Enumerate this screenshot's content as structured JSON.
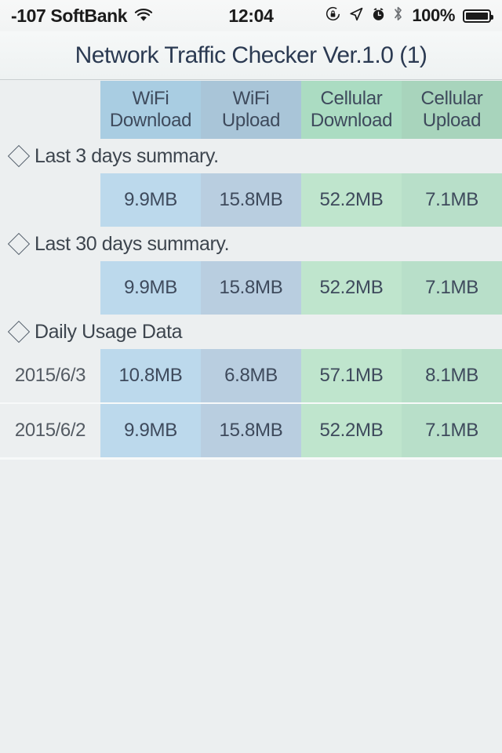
{
  "status_bar": {
    "carrier_signal": "-107",
    "carrier_name": "SoftBank",
    "carrier_text": "-107 SoftBank",
    "wifi_icon": "wifi-icon",
    "time": "12:04",
    "icons": [
      "rotation-lock-icon",
      "location-arrow-icon",
      "alarm-clock-icon",
      "bluetooth-icon"
    ],
    "battery_percent": "100%",
    "battery_level": 100
  },
  "navbar": {
    "title": "Network Traffic Checker Ver.1.0 (1)"
  },
  "table": {
    "columns": [
      {
        "line1": "WiFi",
        "line2": "Download",
        "key": "wifi_download",
        "color": "#a9cde2"
      },
      {
        "line1": "WiFi",
        "line2": "Upload",
        "key": "wifi_upload",
        "color": "#a9c5d8"
      },
      {
        "line1": "Cellular",
        "line2": "Download",
        "key": "cellular_download",
        "color": "#abdcc2"
      },
      {
        "line1": "Cellular",
        "line2": "Upload",
        "key": "cellular_upload",
        "color": "#a8d4bc"
      }
    ],
    "sections": [
      {
        "icon": "diamond-icon",
        "title": "Last 3 days summary.",
        "rows": [
          {
            "label": "",
            "values": [
              "9.9MB",
              "15.8MB",
              "52.2MB",
              "7.1MB"
            ]
          }
        ]
      },
      {
        "icon": "diamond-icon",
        "title": "Last 30 days summary.",
        "rows": [
          {
            "label": "",
            "values": [
              "9.9MB",
              "15.8MB",
              "52.2MB",
              "7.1MB"
            ]
          }
        ]
      },
      {
        "icon": "diamond-icon",
        "title": "Daily Usage Data",
        "rows": [
          {
            "label": "2015/6/3",
            "values": [
              "10.8MB",
              "6.8MB",
              "57.1MB",
              "8.1MB"
            ]
          },
          {
            "label": "2015/6/2",
            "values": [
              "9.9MB",
              "15.8MB",
              "52.2MB",
              "7.1MB"
            ]
          }
        ]
      }
    ]
  },
  "theme": {
    "background": "#eceff0",
    "title_color": "#2b3a52",
    "text_color": "#3e4a5c"
  }
}
